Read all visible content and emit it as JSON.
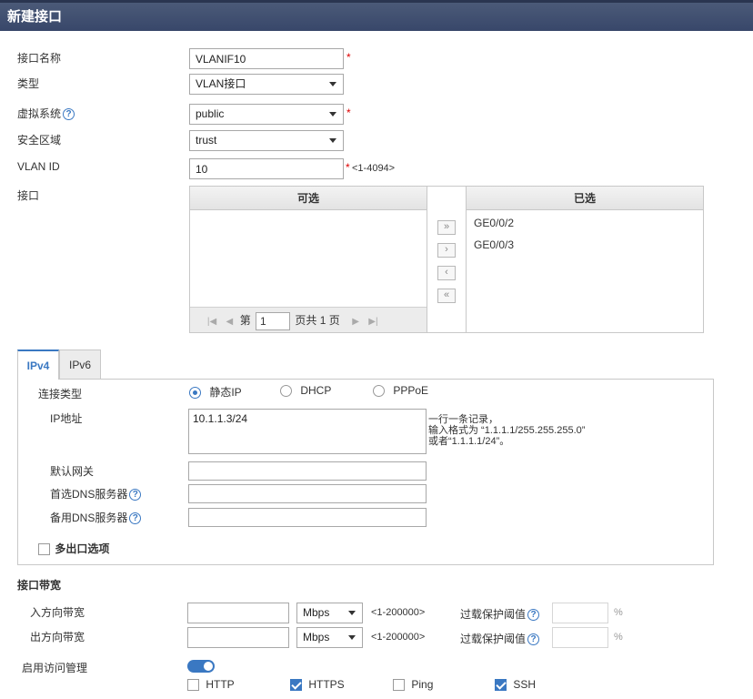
{
  "window": {
    "title": "新建接口"
  },
  "form": {
    "name": {
      "label": "接口名称",
      "value": "VLANIF10"
    },
    "type": {
      "label": "类型",
      "value": "VLAN接口"
    },
    "vsys": {
      "label": "虚拟系统",
      "value": "public"
    },
    "zone": {
      "label": "安全区域",
      "value": "trust"
    },
    "vlan_id": {
      "label": "VLAN ID",
      "value": "10",
      "hint": "<1-4094>"
    },
    "required_mark": "*",
    "help_glyph": "?"
  },
  "interfaces": {
    "label": "接口",
    "available_title": "可选",
    "selected_title": "已选",
    "selected_items": [
      "GE0/0/2",
      "GE0/0/3"
    ],
    "pager": {
      "prefix": "第",
      "page": "1",
      "suffix": "页共 1 页"
    },
    "move_buttons": [
      "»",
      "›",
      "‹",
      "«"
    ]
  },
  "tabs": [
    {
      "label": "IPv4",
      "active": true
    },
    {
      "label": "IPv6",
      "active": false
    }
  ],
  "ipv4": {
    "conn_type_label": "连接类型",
    "conn_options": [
      {
        "label": "静态IP",
        "selected": true
      },
      {
        "label": "DHCP",
        "selected": false
      },
      {
        "label": "PPPoE",
        "selected": false
      }
    ],
    "ip_label": "IP地址",
    "ip_value": "10.1.1.3/24",
    "ip_hint": [
      "一行一条记录，",
      "输入格式为 “1.1.1.1/255.255.255.0”",
      "或者“1.1.1.1/24”。"
    ],
    "gateway_label": "默认网关",
    "dns1_label": "首选DNS服务器",
    "dns2_label": "备用DNS服务器",
    "multi_exit_label": "多出口选项"
  },
  "bandwidth": {
    "section_title": "接口带宽",
    "rows": [
      {
        "label": "入方向带宽",
        "unit": "Mbps",
        "range": "<1-200000>",
        "threshold_label": "过载保护阈值",
        "percent": "%"
      },
      {
        "label": "出方向带宽",
        "unit": "Mbps",
        "range": "<1-200000>",
        "threshold_label": "过载保护阈值",
        "percent": "%"
      }
    ]
  },
  "access": {
    "label": "启用访问管理",
    "enabled": true,
    "protocols": [
      {
        "label": "HTTP",
        "checked": false
      },
      {
        "label": "HTTPS",
        "checked": true
      },
      {
        "label": "Ping",
        "checked": false
      },
      {
        "label": "SSH",
        "checked": true
      }
    ]
  },
  "colors": {
    "accent": "#3a78c2",
    "titlebar": "#3f4e70",
    "required": "#dd0000"
  }
}
